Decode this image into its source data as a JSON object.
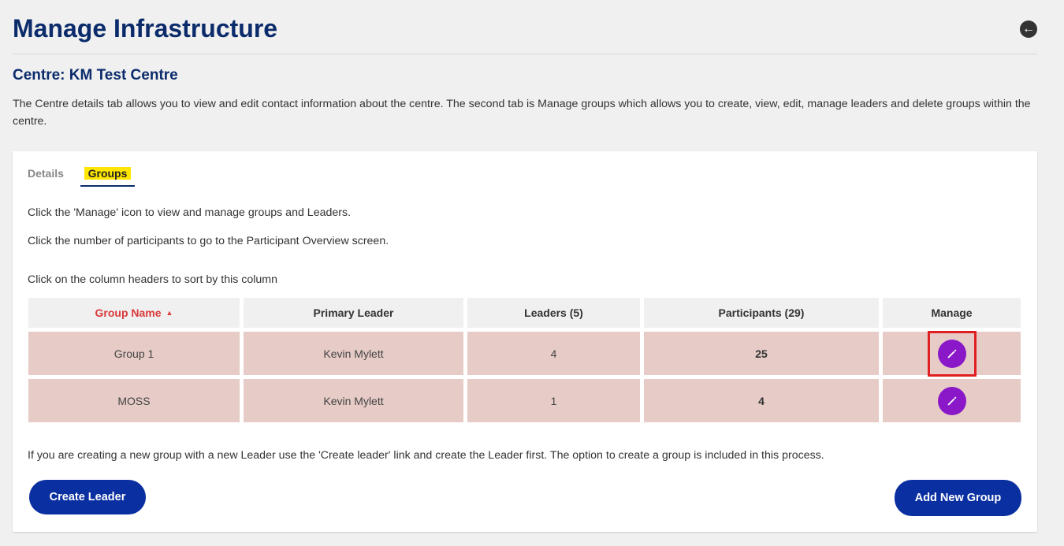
{
  "header": {
    "title": "Manage Infrastructure",
    "back_icon": "arrow-left-circle-icon"
  },
  "centre": {
    "title": "Centre: KM Test Centre",
    "description": "The Centre details tab allows you to view and edit contact information about the centre. The second tab is Manage groups which allows you to create, view, edit, manage leaders and delete groups within the centre."
  },
  "tabs": [
    {
      "label": "Details",
      "active": false
    },
    {
      "label": "Groups",
      "active": true
    }
  ],
  "instructions": {
    "manage": "Click the 'Manage' icon to view and manage groups and Leaders.",
    "participants": "Click the number of participants to go to the Participant Overview screen.",
    "sort": "Click on the column headers to sort by this column"
  },
  "table": {
    "headers": [
      "Group Name",
      "Primary Leader",
      "Leaders (5)",
      "Participants (29)",
      "Manage"
    ],
    "rows": [
      {
        "group_name": "Group 1",
        "primary_leader": "Kevin Mylett",
        "leaders": "4",
        "participants": "25"
      },
      {
        "group_name": "MOSS",
        "primary_leader": "Kevin Mylett",
        "leaders": "1",
        "participants": "4"
      }
    ]
  },
  "footer": {
    "note": "If you are creating a new group with a new Leader use the 'Create leader' link and create the Leader first. The option to create a group is included in this process.",
    "create_leader_label": "Create Leader",
    "add_group_label": "Add New Group"
  },
  "colors": {
    "title": "#0b2b6b",
    "sort_active": "#d93a3a",
    "row_bg": "#e6cbc6",
    "edit_button": "#8a18c8",
    "primary_button": "#0a2fa1",
    "tab_highlight": "#ffe600",
    "focus_outline": "#e02020"
  }
}
